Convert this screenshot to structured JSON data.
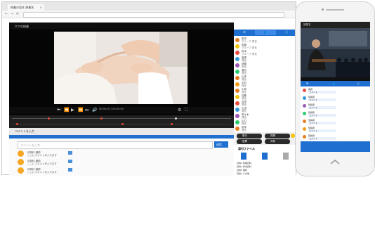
{
  "browser": {
    "tab_title": "授業の見本 授業名",
    "tab_close": "×",
    "nav_back": "←",
    "nav_forward": "→",
    "nav_reload": "⟳"
  },
  "app": {
    "title": "ケアの授業",
    "timecode": "00:00:00 / 00:00:00",
    "subject_label": "ここにタイトル",
    "subject_badge": "授業名",
    "chat_label": "コメントを入力",
    "comment_placeholder": "コメントを入力",
    "send_label": "送信",
    "comments": [
      {
        "name": "体育科 講師",
        "text": "ここにコメントが入ります"
      },
      {
        "name": "体育科 講師",
        "text": "ここにコメントが入ります"
      },
      {
        "name": "体育科 講師",
        "text": "ここにコメントが入ります"
      }
    ]
  },
  "side": {
    "tabs": [
      "",
      "",
      ""
    ],
    "rows": [
      {
        "name": "田中",
        "text": "グループ 発言"
      },
      {
        "name": "佐藤",
        "text": "グループ 発言"
      },
      {
        "name": "鈴木",
        "text": "グループ 発言"
      },
      {
        "name": "高橋",
        "text": "発言"
      },
      {
        "name": "伊藤",
        "text": "発言"
      },
      {
        "name": "渡辺",
        "text": "発言"
      },
      {
        "name": "山本",
        "text": "発言"
      },
      {
        "name": "中村",
        "text": "発言"
      },
      {
        "name": "小林",
        "text": "発言"
      },
      {
        "name": "加藤",
        "text": "発言"
      },
      {
        "name": "吉田",
        "text": "発言"
      },
      {
        "name": "山田",
        "text": "発言"
      },
      {
        "name": "佐々木",
        "text": "発言"
      },
      {
        "name": "山口",
        "text": "発言"
      },
      {
        "name": "松本",
        "text": "発言"
      }
    ],
    "btn1": "挙手",
    "btn2": "質問",
    "btn3": "投票",
    "btn4": "共有",
    "file_header": "添付ファイル",
    "file_rows": [
      "資料1 授業資料",
      "資料2 参考資料",
      "資料3 課題",
      "資料4 その他"
    ]
  },
  "phone": {
    "header": "授業名",
    "tabs": [
      "",
      "",
      ""
    ],
    "rows": [
      {
        "name": "講師",
        "text": "コメント"
      },
      {
        "name": "受講者",
        "text": "コメント"
      },
      {
        "name": "受講者",
        "text": "コメント"
      },
      {
        "name": "受講者",
        "text": "コメント"
      },
      {
        "name": "受講者",
        "text": "コメント"
      },
      {
        "name": "受講者",
        "text": "コメント"
      },
      {
        "name": "受講者",
        "text": "コメント"
      }
    ]
  }
}
